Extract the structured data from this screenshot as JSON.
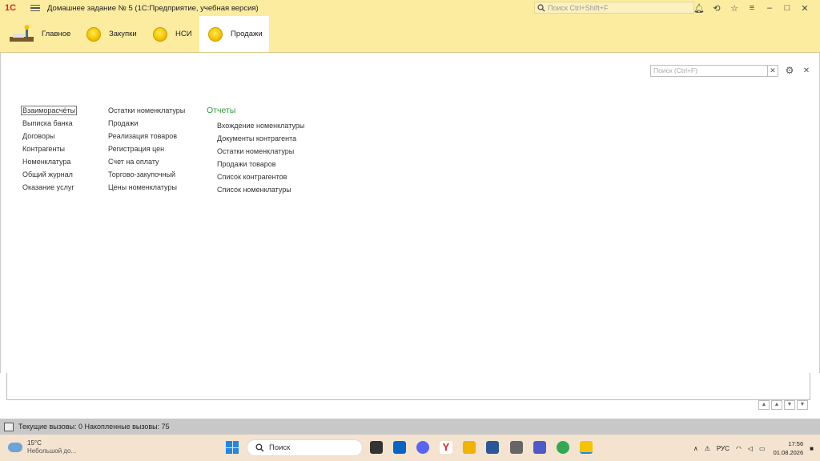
{
  "app": {
    "logo": "1С",
    "title": "Домашнее задание № 5  (1С:Предприятие, учебная версия)",
    "search_placeholder": "Поиск Ctrl+Shift+F"
  },
  "title_icons": [
    "bell-icon",
    "history-icon",
    "star-icon",
    "filter-icon",
    "minimize-icon",
    "restore-icon",
    "close-icon"
  ],
  "sections": [
    {
      "label": "Главное"
    },
    {
      "label": "Закупки"
    },
    {
      "label": "НСИ"
    },
    {
      "label": "Продажи",
      "active": true
    }
  ],
  "panel": {
    "search_placeholder": "Поиск (Ctrl+F)",
    "col1": [
      "Взаиморасчёты",
      "Выписка  банка",
      "Договоры",
      "Контрагенты",
      "Номенклатура",
      "Общий журнал",
      "Оказание услуг"
    ],
    "col2": [
      "Остатки номенклатуры",
      "Продажи",
      "Реализация товаров",
      "Регистрация цен",
      "Счет на оплату",
      "Торгово-закупочный",
      "Цены номенклатуры"
    ],
    "reports_title": "Отчеты",
    "reports": [
      "Вхождение номенклатуры",
      "Документы  контрагента",
      "Остатки номенклатуры",
      "Продажи товаров",
      "Список контрагентов",
      "Список номенклатуры"
    ]
  },
  "status": {
    "text": "Текущие вызовы: 0   Накопленные вызовы: 75"
  },
  "taskbar": {
    "weather_temp": "15°C",
    "weather_desc": "Небольшой до...",
    "search_label": "Поиск",
    "lang": "РУС",
    "time": "17:56",
    "date": "01.08.2026"
  },
  "colors": {
    "accent_yellow": "#fbeca0",
    "report_green": "#2e9a3a",
    "status_gray": "#c8c8c8"
  }
}
